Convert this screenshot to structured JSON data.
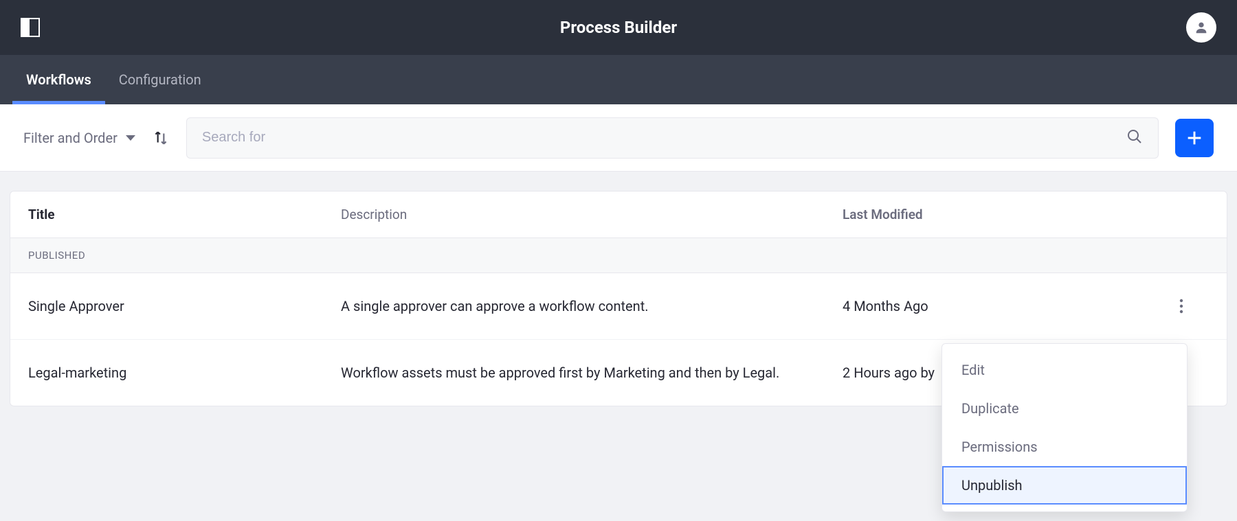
{
  "header": {
    "title": "Process Builder"
  },
  "tabs": {
    "workflows": "Workflows",
    "configuration": "Configuration"
  },
  "toolbar": {
    "filter_order_label": "Filter and Order",
    "search_placeholder": "Search for"
  },
  "table": {
    "columns": {
      "title": "Title",
      "description": "Description",
      "last_modified": "Last Modified"
    },
    "section_label": "PUBLISHED",
    "rows": [
      {
        "title": "Single Approver",
        "description": "A single approver can approve a workflow content.",
        "last_modified": "4 Months Ago"
      },
      {
        "title": "Legal-marketing",
        "description": "Workflow assets must be approved first by Marketing and then by Legal.",
        "last_modified": "2 Hours ago by"
      }
    ]
  },
  "menu": {
    "edit": "Edit",
    "duplicate": "Duplicate",
    "permissions": "Permissions",
    "unpublish": "Unpublish"
  }
}
